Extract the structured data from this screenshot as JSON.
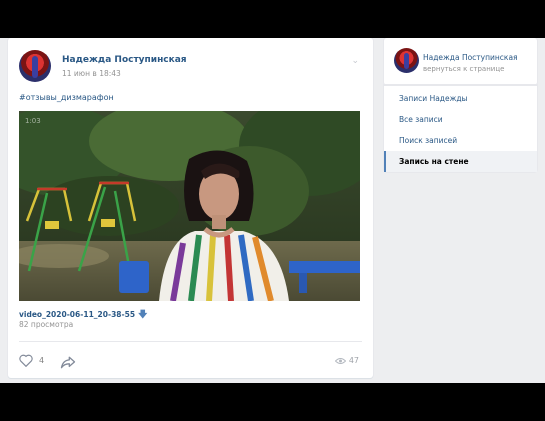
{
  "post": {
    "author": "Надежда Поступинская",
    "date": "11 июн в 18:43",
    "hashtag": "#отзывы_дизмарафон",
    "video": {
      "timestamp": "1:03",
      "filename": "video_2020-06-11_20-38-55",
      "views": "82 просмотра"
    },
    "likes": "4",
    "view_count": "47"
  },
  "sidebar": {
    "name": "Надежда Поступинская",
    "back": "вернуться к странице",
    "items": [
      {
        "label": "Записи Надежды",
        "active": false
      },
      {
        "label": "Все записи",
        "active": false
      },
      {
        "label": "Поиск записей",
        "active": false
      },
      {
        "label": "Запись на стене",
        "active": true
      }
    ]
  }
}
